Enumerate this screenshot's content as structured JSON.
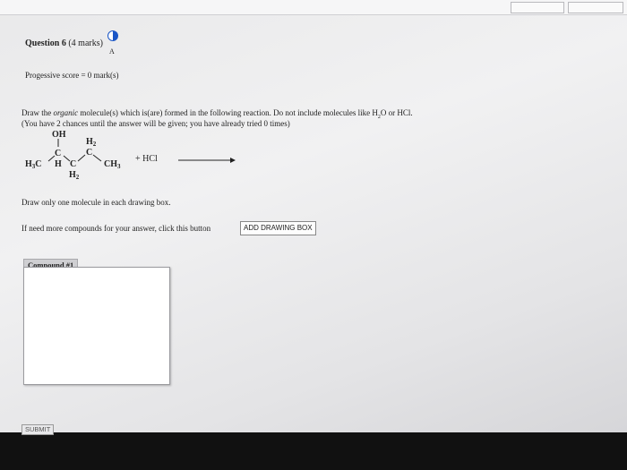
{
  "question": {
    "title": "Question 6",
    "marks": "(4 marks)",
    "status_letter": "A",
    "status_icon": "half-circle-progress-icon"
  },
  "score": "Progessive score = 0 mark(s)",
  "instructions": {
    "line1_prefix": "Draw the ",
    "line1_italic": "organic",
    "line1_suffix": " molecule(s) which is(are) formed in the following reaction. Do not include molecules like H",
    "line1_sub": "2",
    "line1_end": "O or HCl.",
    "line2": "(You have 2 chances until the answer will be given; you have already tried 0 times)"
  },
  "reaction": {
    "oh": "OH",
    "h3c": "H",
    "h3c_sub": "3",
    "h3c_c": "C",
    "c": "C",
    "h": "H",
    "ch2_h": "H",
    "ch2_sub": "2",
    "ch3": "CH",
    "ch3_sub": "3",
    "plus_reagent": "+ HCl"
  },
  "only_one": "Draw only one molecule in each drawing box.",
  "need_more": "If need more compounds for your answer, click this button",
  "add_button": "ADD DRAWING BOX",
  "compound_tab": "Compound #1",
  "submit": "SUBMIT"
}
